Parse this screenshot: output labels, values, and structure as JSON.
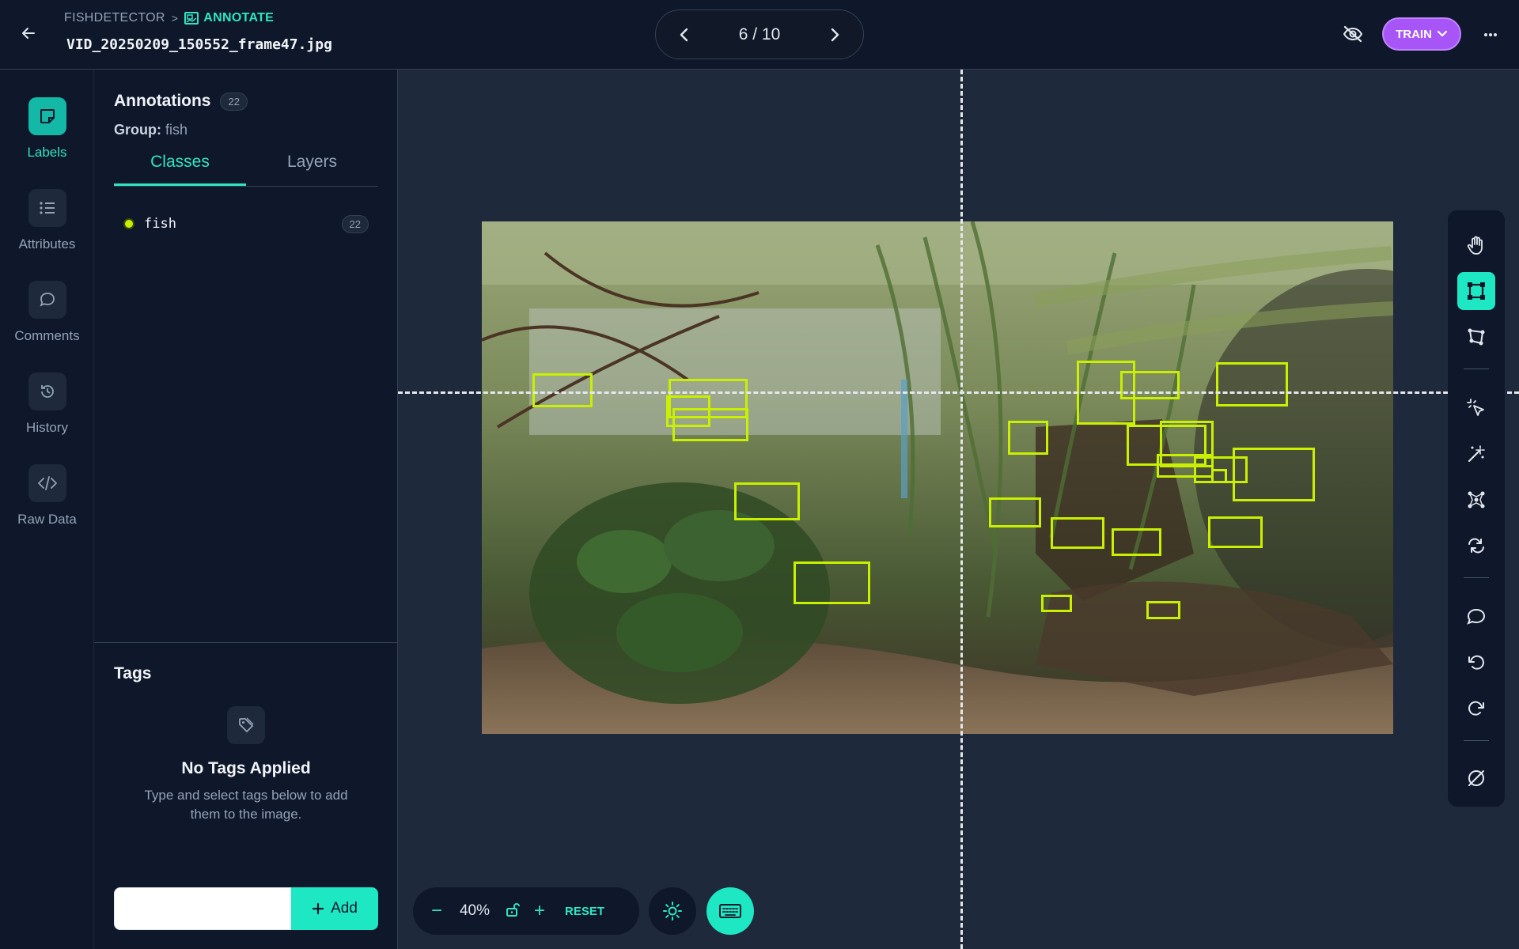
{
  "header": {
    "breadcrumb_project": "FISHDETECTOR",
    "breadcrumb_separator": ">",
    "breadcrumb_mode": "ANNOTATE",
    "filename": "VID_20250209_150552_frame47.jpg",
    "pager": "6 / 10",
    "train_label": "TRAIN"
  },
  "rail": {
    "items": [
      {
        "label": "Labels",
        "icon": "label-icon",
        "active": true
      },
      {
        "label": "Attributes",
        "icon": "list-icon"
      },
      {
        "label": "Comments",
        "icon": "comment-icon"
      },
      {
        "label": "History",
        "icon": "history-icon"
      },
      {
        "label": "Raw Data",
        "icon": "code-icon"
      }
    ]
  },
  "panel": {
    "title": "Annotations",
    "count": "22",
    "group_label": "Group:",
    "group_value": "fish",
    "tabs": [
      "Classes",
      "Layers"
    ],
    "classes": [
      {
        "name": "fish",
        "count": "22",
        "color": "#c8f000"
      }
    ],
    "tags_title": "Tags",
    "no_tags_title": "No Tags Applied",
    "no_tags_sub": "Type and select tags below to add them to the image.",
    "add_label": "Add",
    "tag_input_value": ""
  },
  "canvas": {
    "annotation_color": "#c8f000",
    "image_description_colors": {
      "water": "#7a8a5a",
      "plants": "#3e5a2a",
      "gravel": "#6b5a45"
    }
  },
  "toolbar": {
    "tools": [
      "hand-icon",
      "bounding-box-icon",
      "polygon-icon",
      "smart-select-icon",
      "magic-wand-icon",
      "keypoint-icon",
      "convert-icon",
      "comment-icon",
      "undo-icon",
      "redo-icon",
      "clear-icon"
    ],
    "active": "bounding-box-icon"
  },
  "zoom": {
    "minus": "−",
    "value": "40%",
    "plus": "+",
    "reset": "RESET"
  }
}
